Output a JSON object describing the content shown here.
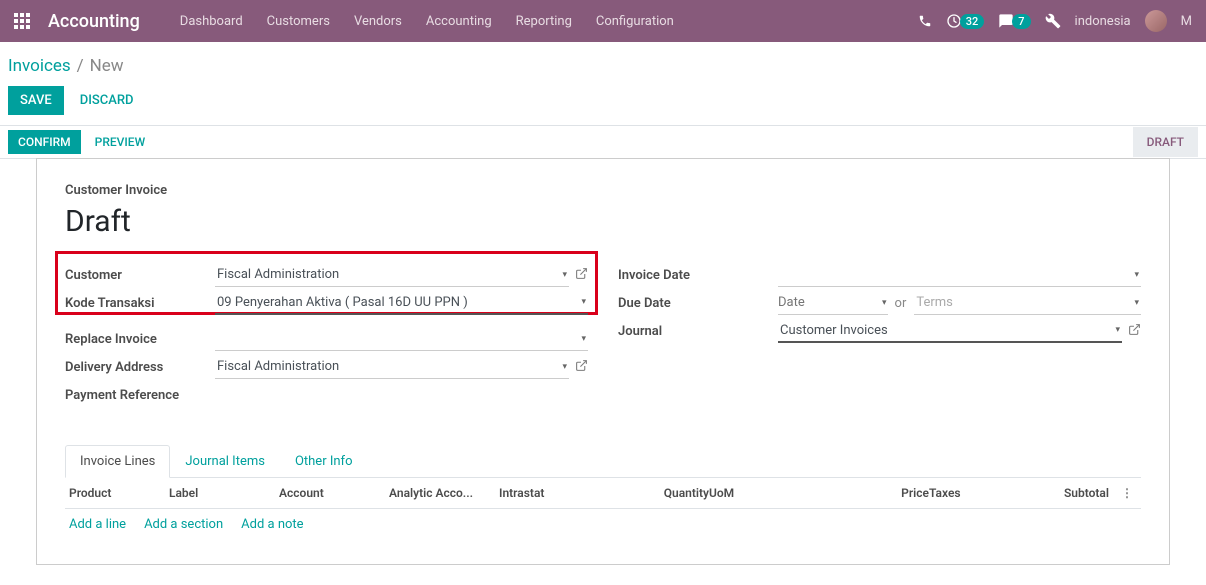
{
  "header": {
    "brand": "Accounting",
    "menu": [
      "Dashboard",
      "Customers",
      "Vendors",
      "Accounting",
      "Reporting",
      "Configuration"
    ],
    "clock_badge": "32",
    "chat_badge": "7",
    "company": "indonesia",
    "user_initial": "M"
  },
  "breadcrumb": {
    "link": "Invoices",
    "current": "New"
  },
  "buttons": {
    "save": "SAVE",
    "discard": "DISCARD",
    "confirm": "CONFIRM",
    "preview": "PREVIEW"
  },
  "status": {
    "draft": "DRAFT"
  },
  "sheet": {
    "title_small": "Customer Invoice",
    "title": "Draft",
    "left": {
      "customer_label": "Customer",
      "customer_value": "Fiscal Administration",
      "kode_label": "Kode Transaksi",
      "kode_value": "09 Penyerahan Aktiva ( Pasal 16D UU PPN )",
      "replace_label": "Replace Invoice",
      "replace_value": "",
      "delivery_label": "Delivery Address",
      "delivery_value": "Fiscal Administration",
      "payref_label": "Payment Reference",
      "payref_value": ""
    },
    "right": {
      "invdate_label": "Invoice Date",
      "duedate_label": "Due Date",
      "date_ph": "Date",
      "or": "or",
      "terms_ph": "Terms",
      "journal_label": "Journal",
      "journal_value": "Customer Invoices"
    }
  },
  "tabs": [
    "Invoice Lines",
    "Journal Items",
    "Other Info"
  ],
  "grid": {
    "cols": {
      "product": "Product",
      "label": "Label",
      "account": "Account",
      "analytic": "Analytic Acco...",
      "intrastat": "Intrastat",
      "qty": "Quantity",
      "uom": "UoM",
      "price": "Price",
      "taxes": "Taxes",
      "subtotal": "Subtotal"
    },
    "add_line": "Add a line",
    "add_section": "Add a section",
    "add_note": "Add a note"
  }
}
